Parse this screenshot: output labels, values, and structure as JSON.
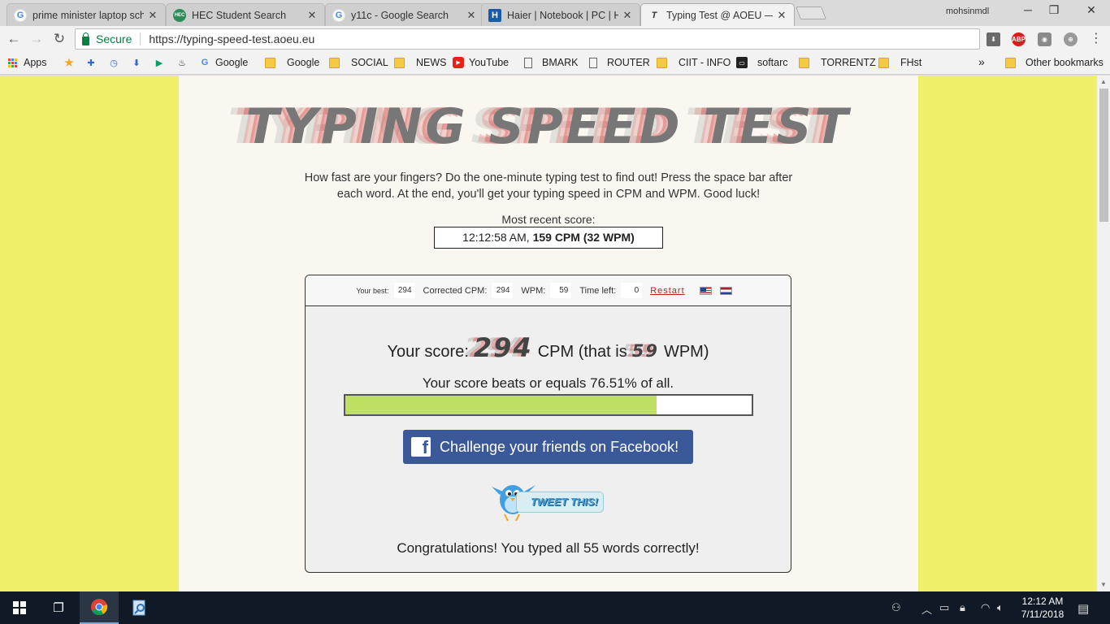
{
  "tabs": [
    {
      "title": "prime minister laptop sch",
      "favicon": "G",
      "active": false
    },
    {
      "title": "HEC Student Search",
      "favicon": "HEC",
      "active": false
    },
    {
      "title": "y11c - Google Search",
      "favicon": "G",
      "active": false
    },
    {
      "title": "Haier | Notebook | PC | H",
      "favicon": "H",
      "active": false
    },
    {
      "title": "Typing Test @ AOEU — Y",
      "favicon": "T",
      "active": true
    }
  ],
  "profile_name": "mohsinmdl",
  "omnibox": {
    "secure_label": "Secure",
    "url": "https://typing-speed-test.aoeu.eu"
  },
  "bookmarks": [
    {
      "label": "Apps",
      "icon": "apps-icon"
    },
    {
      "label": "",
      "icon": "star-icon"
    },
    {
      "label": "",
      "icon": "puzzle-icon"
    },
    {
      "label": "",
      "icon": "history-icon"
    },
    {
      "label": "",
      "icon": "download-icon"
    },
    {
      "label": "",
      "icon": "play-store-icon"
    },
    {
      "label": "",
      "icon": "flame-icon"
    },
    {
      "label": "Google",
      "icon": "google-icon"
    },
    {
      "label": "Google",
      "icon": "folder-icon"
    },
    {
      "label": "SOCIAL",
      "icon": "folder-icon"
    },
    {
      "label": "NEWS",
      "icon": "folder-icon"
    },
    {
      "label": "YouTube",
      "icon": "youtube-icon"
    },
    {
      "label": "BMARK",
      "icon": "page-icon"
    },
    {
      "label": "ROUTER",
      "icon": "page-icon"
    },
    {
      "label": "CIIT - INFO",
      "icon": "folder-icon"
    },
    {
      "label": "softarc",
      "icon": "softarc-icon"
    },
    {
      "label": "TORRENTZ",
      "icon": "folder-icon"
    },
    {
      "label": "FHst",
      "icon": "folder-icon"
    }
  ],
  "bookmarks_overflow": "»",
  "other_bookmarks": "Other bookmarks",
  "page": {
    "logo_text": "TYPING SPEED TEST",
    "intro": "How fast are your fingers? Do the one-minute typing test to find out! Press the space bar after each word. At the end, you'll get your typing speed in CPM and WPM. Good luck!",
    "recent_label": "Most recent score:",
    "recent_time": "12:12:58 AM,",
    "recent_score": "159 CPM (32 WPM)",
    "stats": {
      "best_label": "Your best:",
      "best_value": "294",
      "cpm_label": "Corrected CPM:",
      "cpm_value": "294",
      "wpm_label": "WPM:",
      "wpm_value": "59",
      "time_label": "Time left:",
      "time_value": "0",
      "restart": "Restart"
    },
    "score_prefix": "Your score:",
    "score_cpm": "294",
    "score_mid": "CPM (that is",
    "score_wpm": "59",
    "score_suffix": "WPM)",
    "beats_text": "Your score beats or equals 76.51% of all.",
    "beats_fraction": 0.7651,
    "facebook_button": "Challenge your friends on Facebook!",
    "tweet_button": "TWEET THIS!",
    "congrats": "Congratulations! You typed all 55 words correctly!"
  },
  "taskbar": {
    "time": "12:12 AM",
    "date": "7/11/2018"
  },
  "colors": {
    "page_bg": "#f0ef6a",
    "facebook": "#3b5998",
    "progress": "#bde062",
    "secure": "#0b8043"
  }
}
